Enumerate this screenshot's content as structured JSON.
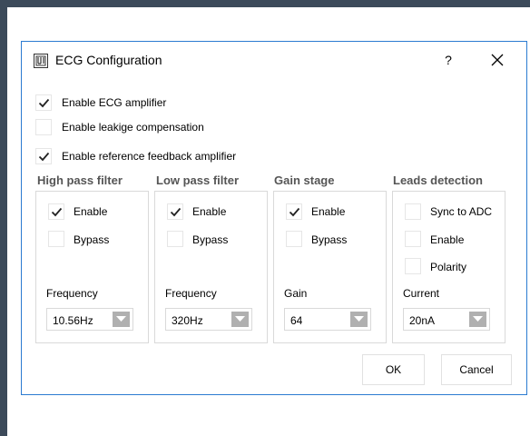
{
  "dialog": {
    "title": "ECG Configuration",
    "help_label": "?",
    "accent_color": "#2b7bd1"
  },
  "options": {
    "enable_ecg_amplifier": {
      "label": "Enable ECG amplifier",
      "checked": true
    },
    "enable_leakage_compensation": {
      "label": "Enable leakige compensation",
      "checked": false
    },
    "enable_reference_feedback": {
      "label": "Enable reference feedback amplifier",
      "checked": true
    }
  },
  "groups": {
    "high_pass": {
      "title": "High pass filter",
      "enable": {
        "label": "Enable",
        "checked": true
      },
      "bypass": {
        "label": "Bypass",
        "checked": false
      },
      "param_label": "Frequency",
      "select_value": "10.56Hz"
    },
    "low_pass": {
      "title": "Low pass filter",
      "enable": {
        "label": "Enable",
        "checked": true
      },
      "bypass": {
        "label": "Bypass",
        "checked": false
      },
      "param_label": "Frequency",
      "select_value": "320Hz"
    },
    "gain": {
      "title": "Gain stage",
      "enable": {
        "label": "Enable",
        "checked": true
      },
      "bypass": {
        "label": "Bypass",
        "checked": false
      },
      "param_label": "Gain",
      "select_value": "64"
    },
    "leads": {
      "title": "Leads detection",
      "sync": {
        "label": "Sync to ADC",
        "checked": false
      },
      "enable": {
        "label": "Enable",
        "checked": false
      },
      "polarity": {
        "label": "Polarity",
        "checked": false
      },
      "param_label": "Current",
      "select_value": "20nA"
    }
  },
  "buttons": {
    "ok": "OK",
    "cancel": "Cancel"
  }
}
